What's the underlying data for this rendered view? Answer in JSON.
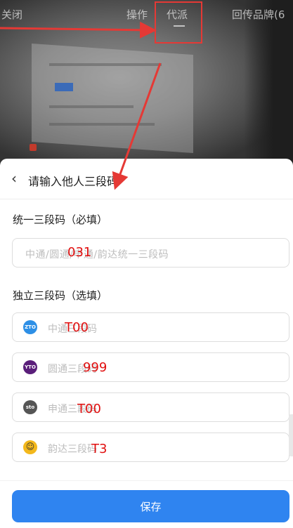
{
  "top_bar": {
    "close": "关闭",
    "op": "操作",
    "dispatch": "代派",
    "return_brand": "回传品牌(6"
  },
  "sheet": {
    "title": "请输入他人三段码",
    "unified_label": "统一三段码（必填）",
    "unified_placeholder": "中通/圆通/申通/韵达统一三段码",
    "unified_value": "031",
    "independent_label": "独立三段码（选填）",
    "carriers": [
      {
        "icon_text": "ZTO",
        "color": "#2d8fe6",
        "placeholder": "中通三段码",
        "value": "T00"
      },
      {
        "icon_text": "YTO",
        "color": "#5a1e7a",
        "placeholder": "圆通三段码",
        "value": "999"
      },
      {
        "icon_text": "sto",
        "color": "#555555",
        "placeholder": "申通三段码",
        "value": "T00"
      },
      {
        "icon_text": "☺",
        "color": "#f3b81c",
        "placeholder": "韵达三段码",
        "value": "T3"
      }
    ],
    "save_label": "保存"
  },
  "colors": {
    "accent": "#2f84f0",
    "annotation": "#e53935"
  }
}
